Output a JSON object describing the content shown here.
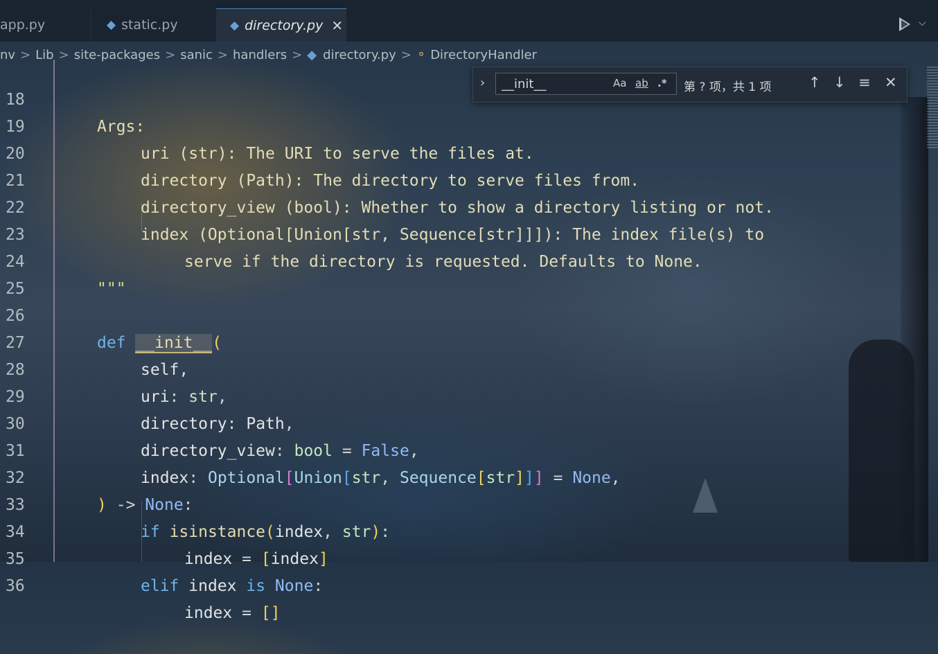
{
  "tabs": [
    {
      "label": "app.py",
      "icon": "python-icon"
    },
    {
      "label": "static.py",
      "icon": "python-icon"
    },
    {
      "label": "directory.py",
      "icon": "python-icon",
      "active": true
    }
  ],
  "tab_close_glyph": "✕",
  "run": {
    "chevron": "⌵"
  },
  "breadcrumb": {
    "items": [
      "nv",
      "Lib",
      "site-packages",
      "sanic",
      "handlers"
    ],
    "separator": ">",
    "file": "directory.py",
    "symbol": "DirectoryHandler"
  },
  "find": {
    "toggle_glyph": "›",
    "query": "__init__",
    "match_case": "Aa",
    "whole_word": "ab",
    "regex": ".*",
    "count": "第 ? 项，共 1 项",
    "prev": "↑",
    "next": "↓",
    "in_selection": "≡",
    "close": "✕"
  },
  "line_numbers": [
    "18",
    "19",
    "20",
    "21",
    "22",
    "23",
    "24",
    "25",
    "26",
    "27",
    "28",
    "29",
    "30",
    "31",
    "32",
    "33",
    "34",
    "35",
    "36"
  ],
  "code": {
    "l18": "Args:",
    "l19": "uri (str): The URI to serve the files at.",
    "l20": "directory (Path): The directory to serve files from.",
    "l21": "directory_view (bool): Whether to show a directory listing or not.",
    "l22": "index (Optional[Union[str, Sequence[str]]]): The index file(s) to",
    "l23": "serve if the directory is requested. Defaults to None.",
    "l24": "\"\"\"",
    "def": "def",
    "init": "__init__",
    "paren_open": "(",
    "self": "self,",
    "uri": "uri",
    "str": "str",
    "directory": "directory",
    "Path": "Path",
    "directory_view": "directory_view",
    "bool": "bool",
    "False": "False",
    "index": "index",
    "Optional": "Optional",
    "Union": "Union",
    "Sequence": "Sequence",
    "None": "None",
    "if": "if",
    "isinstance": "isinstance",
    "elif": "elif",
    "is": "is",
    "arrow": "->",
    "paren_close": ")",
    "colon": ":",
    "comma": ",",
    "eq": "=",
    "lbr": "[",
    "rbr": "]"
  },
  "colors": {
    "keyword": "#6fb3e8",
    "docstring": "#e3ddb6",
    "string": "#cbe08a",
    "type": "#c5e6c0",
    "bracket_yellow": "#f1d15f",
    "bracket_pink": "#d67bd8",
    "bracket_blue": "#5ca5f0"
  }
}
